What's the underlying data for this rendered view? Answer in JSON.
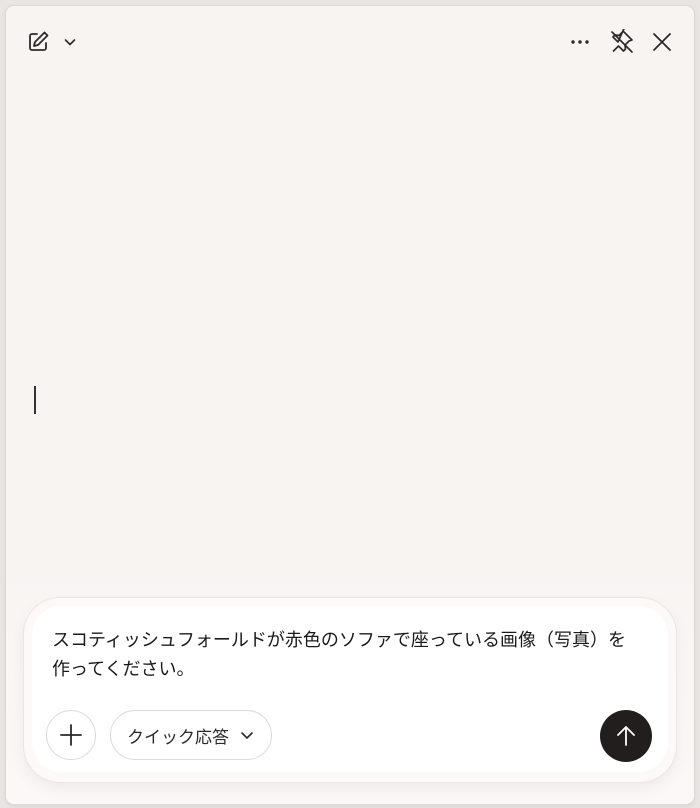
{
  "titlebar": {
    "new_chat_icon": "compose-icon",
    "dropdown_icon": "chevron-down-icon",
    "more_icon": "more-horizontal-icon",
    "unpin_icon": "unpin-icon",
    "close_icon": "close-icon"
  },
  "composer": {
    "prompt_text": "スコティッシュフォールドが赤色のソファで座っている画像（写真）を作ってください。",
    "add_icon": "plus-icon",
    "quick_response_label": "クイック応答",
    "quick_response_icon": "chevron-down-icon",
    "send_icon": "arrow-up-icon"
  },
  "colors": {
    "background": "#f8f4f2",
    "send_button": "#211e1d",
    "text": "#1a1a1a"
  }
}
